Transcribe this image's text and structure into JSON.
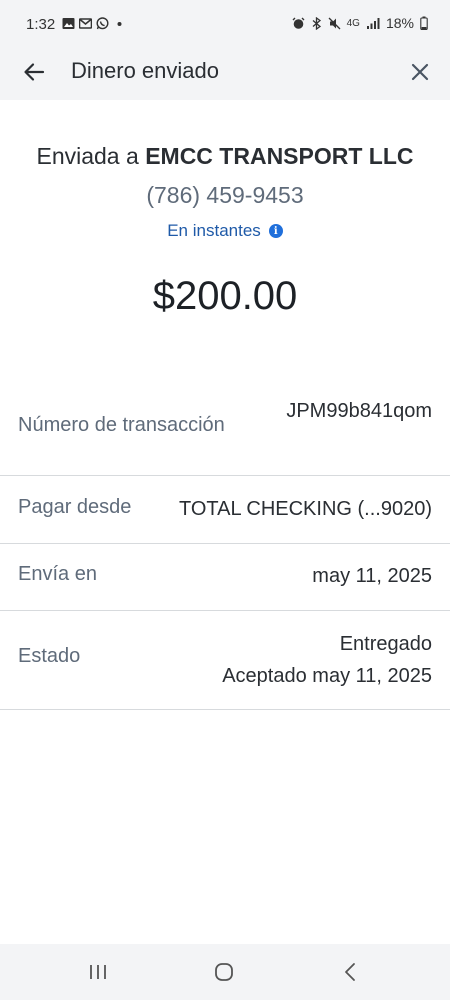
{
  "status_bar": {
    "time": "1:32",
    "battery": "18%",
    "network": "4G",
    "left_icons": [
      "gallery-icon",
      "gmail-icon",
      "whatsapp-icon",
      "dot-icon"
    ],
    "right_icons": [
      "alarm-icon",
      "bluetooth-icon",
      "mute-icon",
      "4g-icon",
      "signal-icon",
      "battery-icon"
    ]
  },
  "header": {
    "title": "Dinero enviado",
    "back_icon": "back-arrow-icon",
    "close_icon": "close-icon"
  },
  "recipient": {
    "prefix": "Enviada a",
    "name": "EMCC TRANSPORT LLC",
    "phone": "(786) 459-9453",
    "timing": "En instantes",
    "info_icon": "info-icon"
  },
  "amount": "$200.00",
  "details": {
    "transaction": {
      "label": "Número de transacción",
      "value": "JPM99b841qom"
    },
    "pay_from": {
      "label": "Pagar desde",
      "value": "TOTAL CHECKING (...9020)"
    },
    "send_on": {
      "label": "Envía en",
      "value": "may 11, 2025"
    },
    "status": {
      "label": "Estado",
      "value": "Entregado",
      "accepted": "Aceptado may 11, 2025"
    }
  },
  "nav_bar": [
    "recent-apps-icon",
    "home-icon",
    "back-icon"
  ],
  "colors": {
    "accent": "#1f6fdb",
    "link": "#1f5aa8",
    "muted": "#5f6b7a",
    "bar_bg": "#f3f4f6"
  }
}
